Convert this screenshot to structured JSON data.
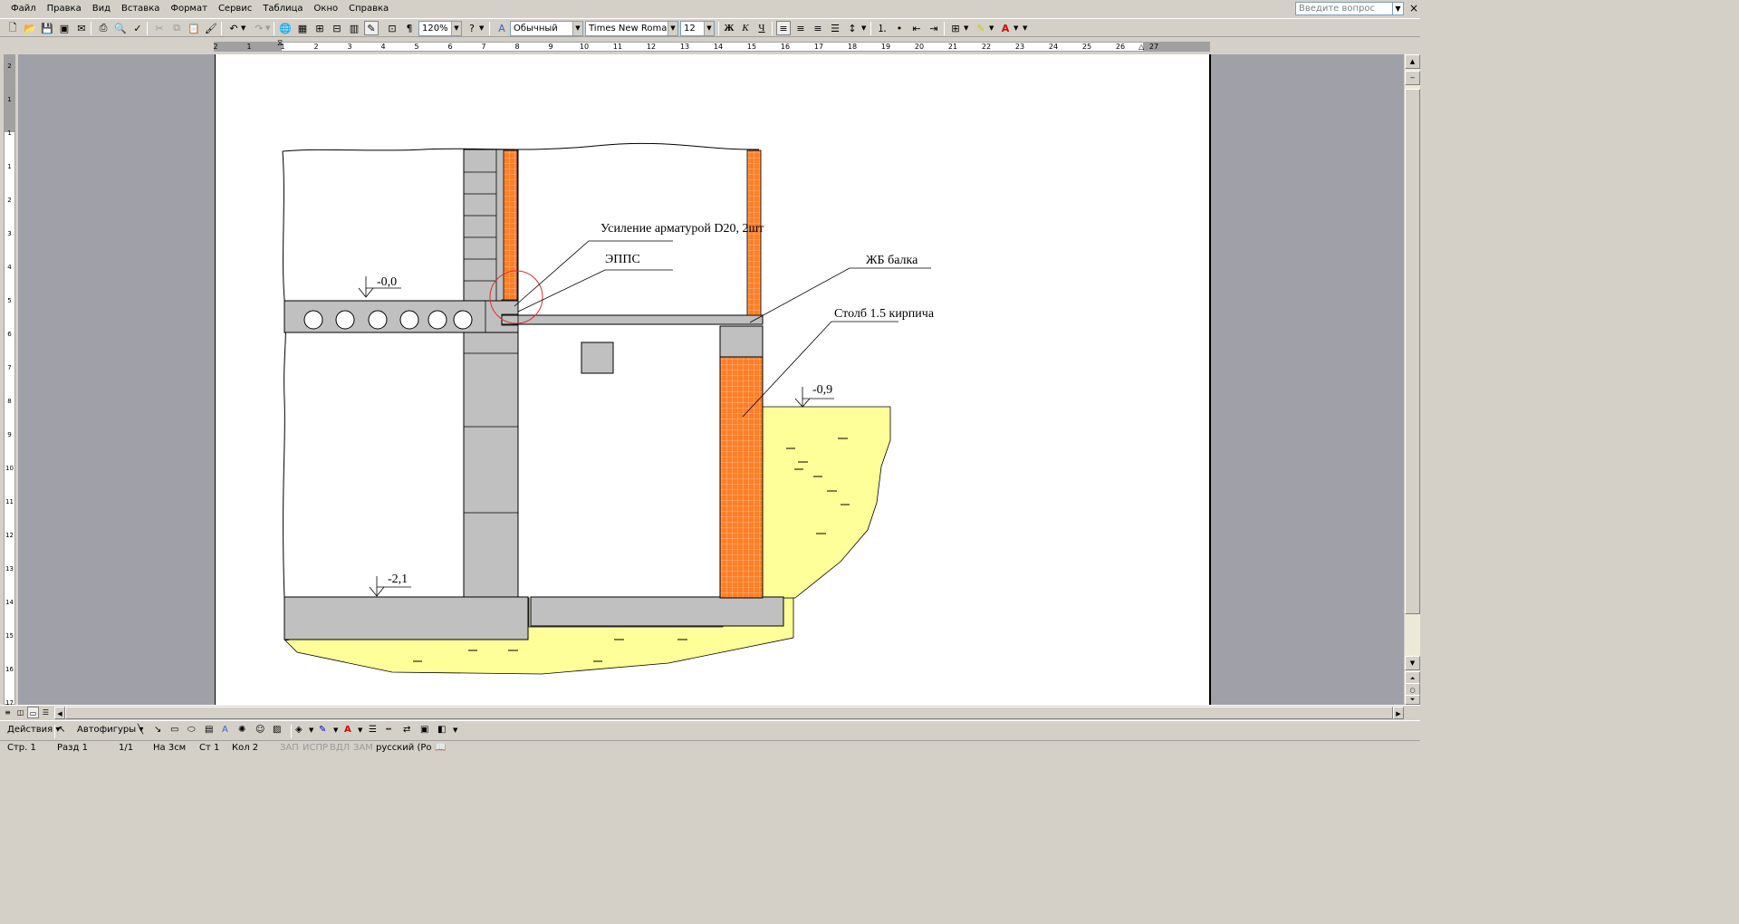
{
  "menu": [
    "Файл",
    "Правка",
    "Вид",
    "Вставка",
    "Формат",
    "Сервис",
    "Таблица",
    "Окно",
    "Справка"
  ],
  "help_placeholder": "Введите вопрос",
  "toolbar": {
    "zoom": "120%",
    "style": "Обычный",
    "font": "Times New Roman",
    "size": "12",
    "bold": "Ж",
    "italic": "К",
    "underline": "Ч"
  },
  "ruler_h": [
    "2",
    "1",
    "1",
    "2",
    "3",
    "4",
    "5",
    "6",
    "7",
    "8",
    "9",
    "10",
    "11",
    "12",
    "13",
    "14",
    "15",
    "16",
    "17",
    "18",
    "19",
    "20",
    "21",
    "22",
    "23",
    "24",
    "25",
    "26",
    "27"
  ],
  "ruler_v": [
    "2",
    "1",
    "1",
    "1",
    "2",
    "3",
    "4",
    "5",
    "6",
    "7",
    "8",
    "9",
    "10",
    "11",
    "12",
    "13",
    "14",
    "15",
    "16",
    "17"
  ],
  "drawing": {
    "labels": {
      "reinforcement": "Усиление арматурой D20, 2шт",
      "epps": "ЭППС",
      "rc_beam": "ЖБ балка",
      "pillar": "Столб 1.5 кирпича",
      "level_0": "-0,0",
      "level_09": "-0,9",
      "level_21": "-2,1"
    },
    "colors": {
      "concrete": "#c0c0c0",
      "brick": "#ff7f27",
      "soil": "#ffff99",
      "callout": "#d93030"
    }
  },
  "drawbar": {
    "actions": "Действия",
    "autoshapes": "Автофигуры"
  },
  "status": {
    "page": "Стр. 1",
    "section": "Разд 1",
    "pages": "1/1",
    "at": "На 3см",
    "line": "Ст 1",
    "col": "Кол 2",
    "rec": "ЗАП",
    "trk": "ИСПР",
    "ext": "ВДЛ",
    "ovr": "ЗАМ",
    "lang": "русский (Ро"
  }
}
